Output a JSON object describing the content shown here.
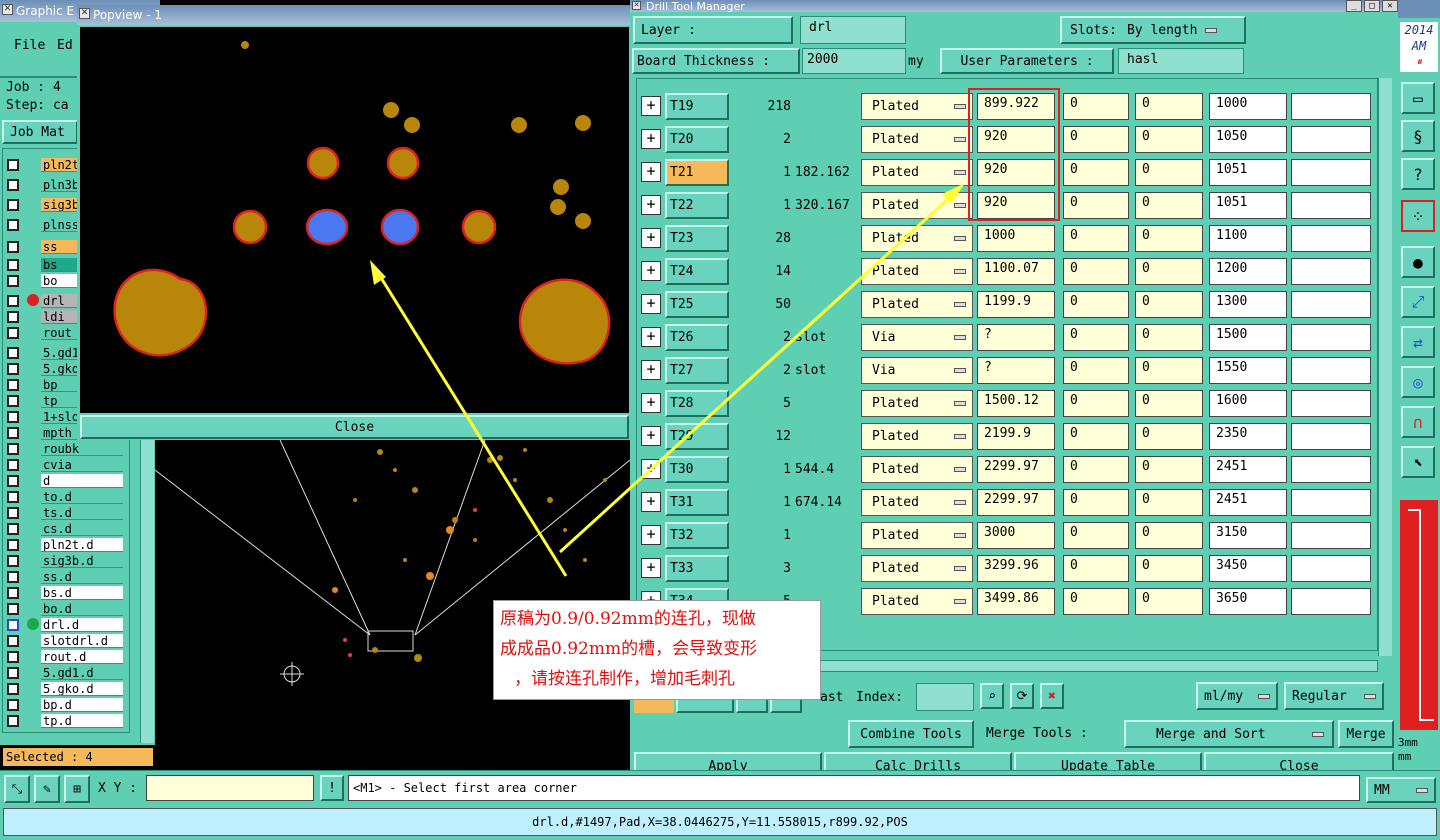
{
  "main_window": {
    "title": "Graphic E",
    "menu": {
      "file": "File",
      "edit": "Ed"
    },
    "job": "Job :  4",
    "step": "Step: ca",
    "job_matrix": "Job Mat",
    "layers": [
      {
        "name": "pln2t",
        "style": "orange"
      },
      {
        "name": "pln3b",
        "style": "teal"
      },
      {
        "name": "sig3b",
        "style": "orange"
      },
      {
        "name": "plnss",
        "style": "teal"
      },
      {
        "name": "ss",
        "style": "orange"
      },
      {
        "name": "bs",
        "style": "green"
      },
      {
        "name": "bo",
        "style": "white"
      },
      {
        "name": "drl",
        "style": "grey"
      },
      {
        "name": "ldi",
        "style": "grey"
      },
      {
        "name": "rout",
        "style": "teal"
      },
      {
        "name": "5.gd1",
        "style": "teal"
      },
      {
        "name": "5.gko",
        "style": "teal"
      },
      {
        "name": "bp",
        "style": "teal"
      },
      {
        "name": "tp",
        "style": "teal"
      },
      {
        "name": "1+slo",
        "style": "teal"
      },
      {
        "name": "mpth",
        "style": "teal"
      },
      {
        "name": "roubk",
        "style": "teal"
      },
      {
        "name": "cvia",
        "style": "teal"
      },
      {
        "name": "d",
        "style": "white"
      },
      {
        "name": "to.d",
        "style": "teal"
      },
      {
        "name": "ts.d",
        "style": "teal"
      },
      {
        "name": "cs.d",
        "style": "teal"
      },
      {
        "name": "pln2t.d",
        "style": "white"
      },
      {
        "name": "sig3b.d",
        "style": "teal"
      },
      {
        "name": "ss.d",
        "style": "teal"
      },
      {
        "name": "bs.d",
        "style": "white"
      },
      {
        "name": "bo.d",
        "style": "teal"
      },
      {
        "name": "drl.d",
        "style": "white"
      },
      {
        "name": "slotdrl.d",
        "style": "white"
      },
      {
        "name": "rout.d",
        "style": "white"
      },
      {
        "name": "5.gd1.d",
        "style": "teal"
      },
      {
        "name": "5.gko.d",
        "style": "white"
      },
      {
        "name": "bp.d",
        "style": "white"
      },
      {
        "name": "tp.d",
        "style": "white"
      }
    ],
    "selected": "Selected : 4",
    "xy_label": "X Y :",
    "xy_value": "",
    "prompt": "<M1> - Select first area corner",
    "status_line": "drl.d,#1497,Pad,X=38.0446275,Y=11.558015,r899.92,POS"
  },
  "popview": {
    "title": "Popview - 1",
    "close_label": "Close"
  },
  "annotation": {
    "line1": "原稿为0.9/0.92mm的连孔，现做",
    "line2": "成成品0.92mm的槽，会导致变形",
    "line3": "，请按连孔制作，增加毛刺孔"
  },
  "drill_tool_manager": {
    "title": "Drill Tool Manager",
    "layer_label": "Layer             :",
    "layer_value": "drl",
    "slots_label": "Slots:",
    "slots_value": "By length",
    "board_thickness_label": "Board Thickness :",
    "board_thickness_value": "2000",
    "units_suffix": "my",
    "user_params_label": "User Parameters :",
    "user_params_value": "hasl",
    "rows": [
      {
        "tool": "T19",
        "count": "218",
        "shape": "",
        "type": "Plated",
        "size": "899.922",
        "p1": "0",
        "p2": "0",
        "finish": "1000",
        "extra": ""
      },
      {
        "tool": "T20",
        "count": "2",
        "shape": "",
        "type": "Plated",
        "size": "920",
        "p1": "0",
        "p2": "0",
        "finish": "1050",
        "extra": ""
      },
      {
        "tool": "T21",
        "count": "1",
        "shape": "182.162",
        "type": "Plated",
        "size": "920",
        "p1": "0",
        "p2": "0",
        "finish": "1051",
        "extra": ""
      },
      {
        "tool": "T22",
        "count": "1",
        "shape": "320.167",
        "type": "Plated",
        "size": "920",
        "p1": "0",
        "p2": "0",
        "finish": "1051",
        "extra": ""
      },
      {
        "tool": "T23",
        "count": "28",
        "shape": "",
        "type": "Plated",
        "size": "1000",
        "p1": "0",
        "p2": "0",
        "finish": "1100",
        "extra": ""
      },
      {
        "tool": "T24",
        "count": "14",
        "shape": "",
        "type": "Plated",
        "size": "1100.07",
        "p1": "0",
        "p2": "0",
        "finish": "1200",
        "extra": ""
      },
      {
        "tool": "T25",
        "count": "50",
        "shape": "",
        "type": "Plated",
        "size": "1199.9",
        "p1": "0",
        "p2": "0",
        "finish": "1300",
        "extra": ""
      },
      {
        "tool": "T26",
        "count": "2",
        "shape": "slot",
        "type": "Via",
        "size": "?",
        "p1": "0",
        "p2": "0",
        "finish": "1500",
        "extra": ""
      },
      {
        "tool": "T27",
        "count": "2",
        "shape": "slot",
        "type": "Via",
        "size": "?",
        "p1": "0",
        "p2": "0",
        "finish": "1550",
        "extra": ""
      },
      {
        "tool": "T28",
        "count": "5",
        "shape": "",
        "type": "Plated",
        "size": "1500.12",
        "p1": "0",
        "p2": "0",
        "finish": "1600",
        "extra": ""
      },
      {
        "tool": "T29",
        "count": "12",
        "shape": "",
        "type": "Plated",
        "size": "2199.9",
        "p1": "0",
        "p2": "0",
        "finish": "2350",
        "extra": ""
      },
      {
        "tool": "T30",
        "count": "1",
        "shape": "544.4",
        "type": "Plated",
        "size": "2299.97",
        "p1": "0",
        "p2": "0",
        "finish": "2451",
        "extra": ""
      },
      {
        "tool": "T31",
        "count": "1",
        "shape": "674.14",
        "type": "Plated",
        "size": "2299.97",
        "p1": "0",
        "p2": "0",
        "finish": "2451",
        "extra": ""
      },
      {
        "tool": "T32",
        "count": "1",
        "shape": "",
        "type": "Plated",
        "size": "3000",
        "p1": "0",
        "p2": "0",
        "finish": "3150",
        "extra": ""
      },
      {
        "tool": "T33",
        "count": "3",
        "shape": "",
        "type": "Plated",
        "size": "3299.96",
        "p1": "0",
        "p2": "0",
        "finish": "3450",
        "extra": ""
      },
      {
        "tool": "T34",
        "count": "5",
        "shape": "",
        "type": "Plated",
        "size": "3499.86",
        "p1": "0",
        "p2": "0",
        "finish": "3650",
        "extra": ""
      }
    ],
    "last_label": "ast",
    "index_label": "Index:",
    "index_value": "",
    "units_select": "ml/my",
    "mode_select": "Regular",
    "combine_tools": "Combine Tools",
    "merge_tools_label": "Merge Tools :",
    "merge_sort": "Merge and Sort",
    "merge": "Merge",
    "apply": "Apply",
    "calc_drills": "Calc Drills",
    "update_table": "Update Table",
    "close": "Close"
  },
  "clock": {
    "year": "2014",
    "ampm": "AM"
  },
  "units_readout": {
    "top": "3mm",
    "bottom": "mm",
    "mm_select": "MM"
  },
  "colors": {
    "teal": "#5fcfb4",
    "pad": "#b8860b",
    "outline": "#e02020",
    "blue": "#4a78f0",
    "annotation_text": "#e01010",
    "arrow": "#ffff33"
  }
}
